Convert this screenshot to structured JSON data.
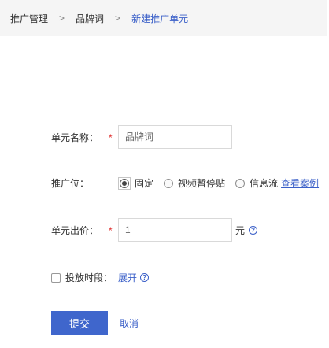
{
  "breadcrumb": {
    "items": [
      "推广管理",
      "品牌词",
      "新建推广单元"
    ],
    "separator": ">"
  },
  "form": {
    "unit_name": {
      "label": "单元名称：",
      "required_mark": "*",
      "placeholder": "品牌词",
      "value": ""
    },
    "position": {
      "label": "推广位：",
      "options": [
        "固定",
        "视频暂停贴",
        "信息流"
      ],
      "selected": "固定",
      "case_link": "查看案例"
    },
    "bid": {
      "label": "单元出价：",
      "required_mark": "*",
      "value": "1",
      "unit": "元",
      "help_icon": "question-circle-icon"
    },
    "schedule": {
      "label": "投放时段：",
      "checked": false,
      "expand_link": "展开",
      "help_icon": "question-circle-icon"
    }
  },
  "actions": {
    "submit_label": "提交",
    "cancel_label": "取消"
  },
  "colors": {
    "accent": "#3f66cc",
    "link": "#3a5fc8",
    "required": "#e0302f",
    "breadcrumb_bg": "#f5f5f5"
  }
}
